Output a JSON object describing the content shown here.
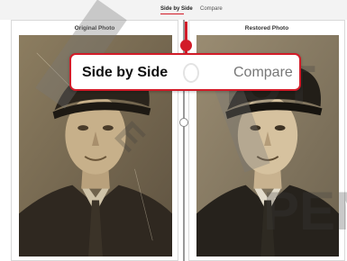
{
  "tabs": {
    "active_label": "Side by Side",
    "inactive_label": "Compare"
  },
  "panels": {
    "left_label": "Original Photo",
    "right_label": "Restored Photo"
  },
  "callout": {
    "active_label": "Side by Side",
    "inactive_label": "Compare"
  },
  "colors": {
    "accent": "#d21b28",
    "original_tone": "#7a6a4e",
    "restored_tone": "#8d7f68"
  },
  "watermark_text": [
    "PEN",
    "IOT",
    "E"
  ]
}
